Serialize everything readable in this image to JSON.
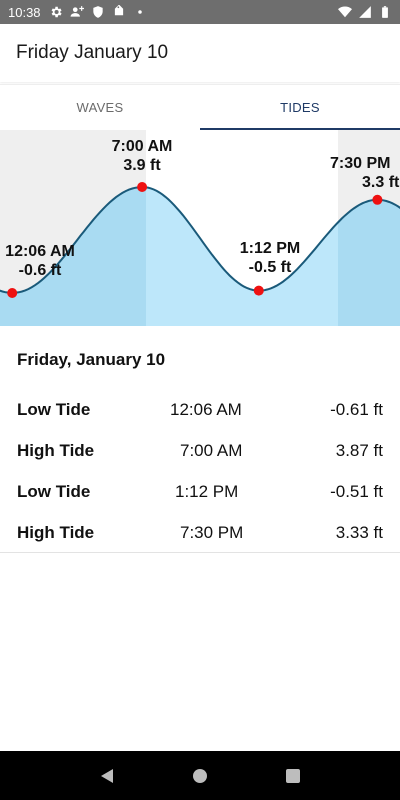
{
  "status_bar": {
    "time": "10:38",
    "left_icons": [
      "gear-icon",
      "person-add-icon",
      "shield-icon",
      "tag-icon",
      "dot-icon"
    ],
    "right_icons": [
      "wifi-icon",
      "signal-icon",
      "battery-icon"
    ]
  },
  "header": {
    "title": "Friday January 10"
  },
  "tabs": [
    {
      "label": "WAVES",
      "active": false
    },
    {
      "label": "TIDES",
      "active": true
    }
  ],
  "chart_data": {
    "type": "area",
    "title": "",
    "xlabel": "",
    "ylabel": "",
    "series": [
      {
        "points": [
          {
            "time": "12:06 AM",
            "height": -0.61
          },
          {
            "time": "7:00 AM",
            "height": 3.87
          },
          {
            "time": "1:12 PM",
            "height": -0.51
          },
          {
            "time": "7:30 PM",
            "height": 3.33
          }
        ]
      }
    ],
    "annotations": [
      {
        "time": "12:06 AM",
        "label": "-0.6 ft"
      },
      {
        "time": "7:00 AM",
        "label": "3.9 ft"
      },
      {
        "time": "1:12 PM",
        "label": "-0.5 ft"
      },
      {
        "time": "7:30 PM",
        "label": "3.3 ft"
      }
    ],
    "shaded_regions": [
      "night-before-sunrise",
      "night-after-sunset"
    ],
    "colors": {
      "line": "#1a5a7a",
      "fill_day": "#bde7fa",
      "fill_night": "#a9dbf2",
      "night_bg": "#efefef",
      "point": "#ee1111"
    }
  },
  "details": {
    "date": "Friday, January 10",
    "rows": [
      {
        "type": "Low Tide",
        "time": "12:06 AM",
        "height": "-0.61 ft"
      },
      {
        "type": "High Tide",
        "time": "7:00 AM",
        "height": "3.87 ft"
      },
      {
        "type": "Low Tide",
        "time": "1:12 PM",
        "height": "-0.51 ft"
      },
      {
        "type": "High Tide",
        "time": "7:30 PM",
        "height": "3.33 ft"
      }
    ]
  },
  "nav_bar": {
    "buttons": [
      "back-icon",
      "home-icon",
      "recents-icon"
    ]
  },
  "colors": {
    "accent": "#1f3a66",
    "status_bar": "#6e6e6e"
  }
}
